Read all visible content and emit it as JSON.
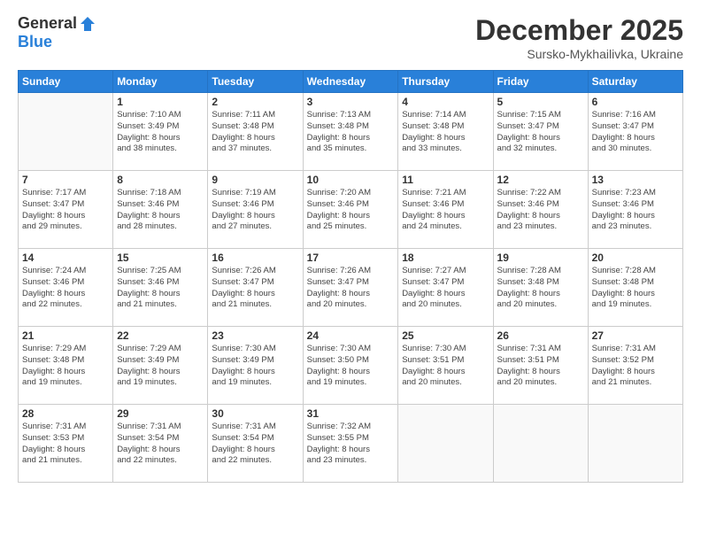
{
  "logo": {
    "general": "General",
    "blue": "Blue"
  },
  "header": {
    "month": "December 2025",
    "location": "Sursko-Mykhailivka, Ukraine"
  },
  "weekdays": [
    "Sunday",
    "Monday",
    "Tuesday",
    "Wednesday",
    "Thursday",
    "Friday",
    "Saturday"
  ],
  "weeks": [
    [
      {
        "day": "",
        "sunrise": "",
        "sunset": "",
        "daylight": ""
      },
      {
        "day": "1",
        "sunrise": "Sunrise: 7:10 AM",
        "sunset": "Sunset: 3:49 PM",
        "daylight": "Daylight: 8 hours and 38 minutes."
      },
      {
        "day": "2",
        "sunrise": "Sunrise: 7:11 AM",
        "sunset": "Sunset: 3:48 PM",
        "daylight": "Daylight: 8 hours and 37 minutes."
      },
      {
        "day": "3",
        "sunrise": "Sunrise: 7:13 AM",
        "sunset": "Sunset: 3:48 PM",
        "daylight": "Daylight: 8 hours and 35 minutes."
      },
      {
        "day": "4",
        "sunrise": "Sunrise: 7:14 AM",
        "sunset": "Sunset: 3:48 PM",
        "daylight": "Daylight: 8 hours and 33 minutes."
      },
      {
        "day": "5",
        "sunrise": "Sunrise: 7:15 AM",
        "sunset": "Sunset: 3:47 PM",
        "daylight": "Daylight: 8 hours and 32 minutes."
      },
      {
        "day": "6",
        "sunrise": "Sunrise: 7:16 AM",
        "sunset": "Sunset: 3:47 PM",
        "daylight": "Daylight: 8 hours and 30 minutes."
      }
    ],
    [
      {
        "day": "7",
        "sunrise": "Sunrise: 7:17 AM",
        "sunset": "Sunset: 3:47 PM",
        "daylight": "Daylight: 8 hours and 29 minutes."
      },
      {
        "day": "8",
        "sunrise": "Sunrise: 7:18 AM",
        "sunset": "Sunset: 3:46 PM",
        "daylight": "Daylight: 8 hours and 28 minutes."
      },
      {
        "day": "9",
        "sunrise": "Sunrise: 7:19 AM",
        "sunset": "Sunset: 3:46 PM",
        "daylight": "Daylight: 8 hours and 27 minutes."
      },
      {
        "day": "10",
        "sunrise": "Sunrise: 7:20 AM",
        "sunset": "Sunset: 3:46 PM",
        "daylight": "Daylight: 8 hours and 25 minutes."
      },
      {
        "day": "11",
        "sunrise": "Sunrise: 7:21 AM",
        "sunset": "Sunset: 3:46 PM",
        "daylight": "Daylight: 8 hours and 24 minutes."
      },
      {
        "day": "12",
        "sunrise": "Sunrise: 7:22 AM",
        "sunset": "Sunset: 3:46 PM",
        "daylight": "Daylight: 8 hours and 23 minutes."
      },
      {
        "day": "13",
        "sunrise": "Sunrise: 7:23 AM",
        "sunset": "Sunset: 3:46 PM",
        "daylight": "Daylight: 8 hours and 23 minutes."
      }
    ],
    [
      {
        "day": "14",
        "sunrise": "Sunrise: 7:24 AM",
        "sunset": "Sunset: 3:46 PM",
        "daylight": "Daylight: 8 hours and 22 minutes."
      },
      {
        "day": "15",
        "sunrise": "Sunrise: 7:25 AM",
        "sunset": "Sunset: 3:46 PM",
        "daylight": "Daylight: 8 hours and 21 minutes."
      },
      {
        "day": "16",
        "sunrise": "Sunrise: 7:26 AM",
        "sunset": "Sunset: 3:47 PM",
        "daylight": "Daylight: 8 hours and 21 minutes."
      },
      {
        "day": "17",
        "sunrise": "Sunrise: 7:26 AM",
        "sunset": "Sunset: 3:47 PM",
        "daylight": "Daylight: 8 hours and 20 minutes."
      },
      {
        "day": "18",
        "sunrise": "Sunrise: 7:27 AM",
        "sunset": "Sunset: 3:47 PM",
        "daylight": "Daylight: 8 hours and 20 minutes."
      },
      {
        "day": "19",
        "sunrise": "Sunrise: 7:28 AM",
        "sunset": "Sunset: 3:48 PM",
        "daylight": "Daylight: 8 hours and 20 minutes."
      },
      {
        "day": "20",
        "sunrise": "Sunrise: 7:28 AM",
        "sunset": "Sunset: 3:48 PM",
        "daylight": "Daylight: 8 hours and 19 minutes."
      }
    ],
    [
      {
        "day": "21",
        "sunrise": "Sunrise: 7:29 AM",
        "sunset": "Sunset: 3:48 PM",
        "daylight": "Daylight: 8 hours and 19 minutes."
      },
      {
        "day": "22",
        "sunrise": "Sunrise: 7:29 AM",
        "sunset": "Sunset: 3:49 PM",
        "daylight": "Daylight: 8 hours and 19 minutes."
      },
      {
        "day": "23",
        "sunrise": "Sunrise: 7:30 AM",
        "sunset": "Sunset: 3:49 PM",
        "daylight": "Daylight: 8 hours and 19 minutes."
      },
      {
        "day": "24",
        "sunrise": "Sunrise: 7:30 AM",
        "sunset": "Sunset: 3:50 PM",
        "daylight": "Daylight: 8 hours and 19 minutes."
      },
      {
        "day": "25",
        "sunrise": "Sunrise: 7:30 AM",
        "sunset": "Sunset: 3:51 PM",
        "daylight": "Daylight: 8 hours and 20 minutes."
      },
      {
        "day": "26",
        "sunrise": "Sunrise: 7:31 AM",
        "sunset": "Sunset: 3:51 PM",
        "daylight": "Daylight: 8 hours and 20 minutes."
      },
      {
        "day": "27",
        "sunrise": "Sunrise: 7:31 AM",
        "sunset": "Sunset: 3:52 PM",
        "daylight": "Daylight: 8 hours and 21 minutes."
      }
    ],
    [
      {
        "day": "28",
        "sunrise": "Sunrise: 7:31 AM",
        "sunset": "Sunset: 3:53 PM",
        "daylight": "Daylight: 8 hours and 21 minutes."
      },
      {
        "day": "29",
        "sunrise": "Sunrise: 7:31 AM",
        "sunset": "Sunset: 3:54 PM",
        "daylight": "Daylight: 8 hours and 22 minutes."
      },
      {
        "day": "30",
        "sunrise": "Sunrise: 7:31 AM",
        "sunset": "Sunset: 3:54 PM",
        "daylight": "Daylight: 8 hours and 22 minutes."
      },
      {
        "day": "31",
        "sunrise": "Sunrise: 7:32 AM",
        "sunset": "Sunset: 3:55 PM",
        "daylight": "Daylight: 8 hours and 23 minutes."
      },
      {
        "day": "",
        "sunrise": "",
        "sunset": "",
        "daylight": ""
      },
      {
        "day": "",
        "sunrise": "",
        "sunset": "",
        "daylight": ""
      },
      {
        "day": "",
        "sunrise": "",
        "sunset": "",
        "daylight": ""
      }
    ]
  ]
}
